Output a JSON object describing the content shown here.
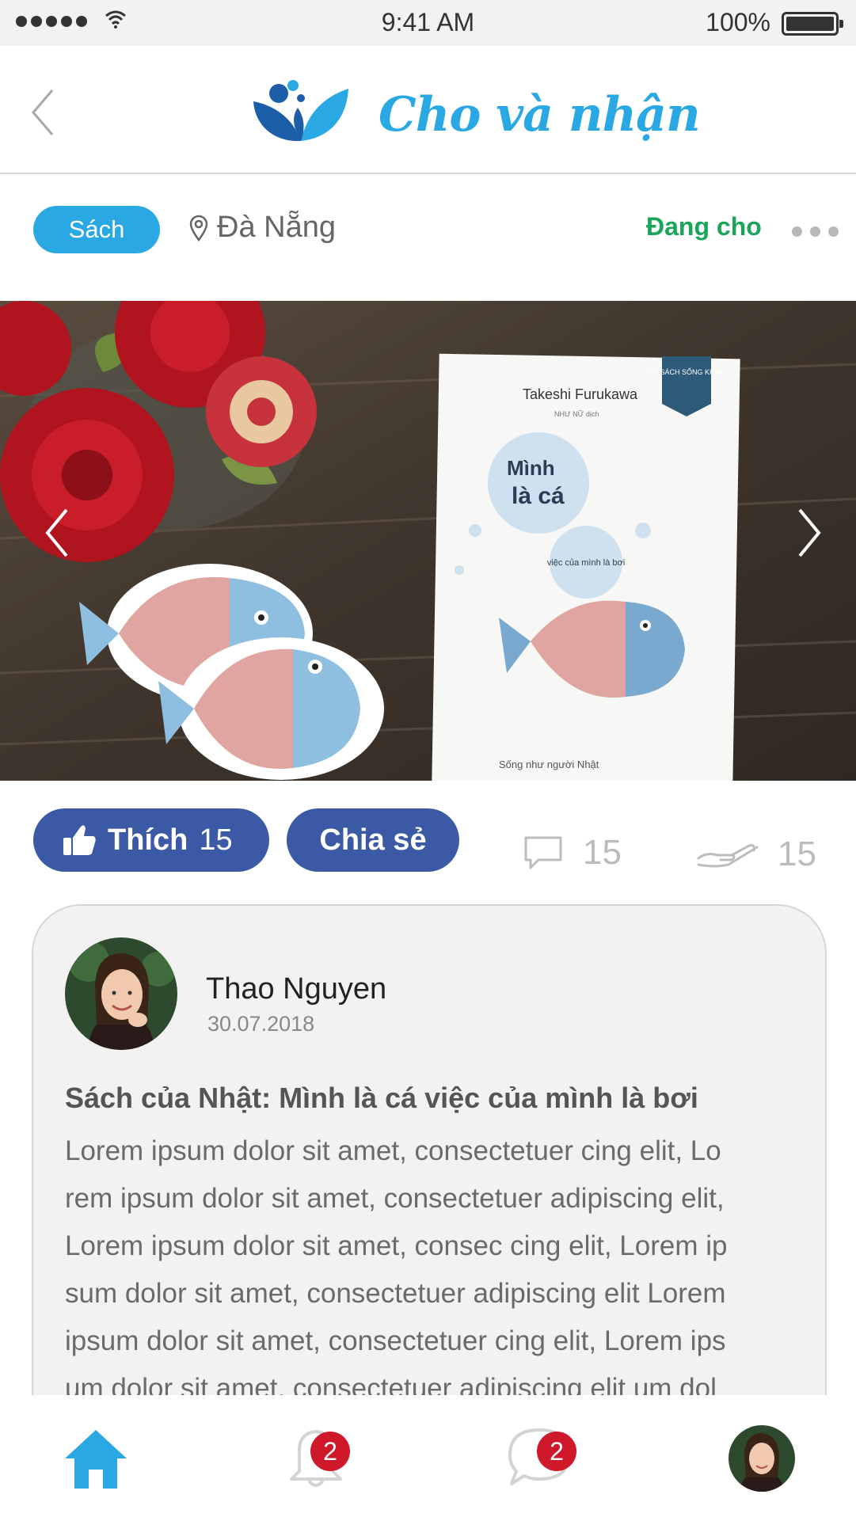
{
  "status_bar": {
    "time": "9:41 AM",
    "battery": "100%"
  },
  "header": {
    "app_title": "Cho và nhận",
    "logo_color": "#2aa8e4"
  },
  "post_meta": {
    "category": "Sách",
    "location": "Đà Nẵng",
    "status": "Đang cho"
  },
  "actions": {
    "like_label": "Thích",
    "like_count": "15",
    "share_label": "Chia sẻ",
    "comment_count": "15",
    "receive_count": "15"
  },
  "post": {
    "author": "Thao Nguyen",
    "date": "30.07.2018",
    "title": "Sách của Nhật: Mình là cá việc của mình là bơi",
    "body_lines": [
      "Lorem ipsum dolor sit amet, consectetuer  cing elit, Lo",
      "rem ipsum dolor sit amet, consectetuer adipiscing elit,",
      "Lorem ipsum dolor sit amet, consec cing elit, Lorem ip",
      "sum dolor sit amet, consectetuer adipiscing elit Lorem",
      "ipsum dolor sit amet, consectetuer cing elit, Lorem ips",
      "um dolor sit amet, consectetuer adipiscing elit um dol"
    ]
  },
  "book_cover": {
    "series": "TỦ SÁCH SỐNG KHÁC",
    "author": "Takeshi Furukawa",
    "translator": "NHƯ NỮ dịch",
    "title_line1": "Mình",
    "title_line2": "là cá",
    "subtitle": "việc của mình là bơi",
    "tagline": "Sống như người Nhật"
  },
  "nav": {
    "bell_badge": "2",
    "chat_badge": "2"
  },
  "colors": {
    "accent": "#2aa8e4",
    "facebook_blue": "#3b59a5",
    "status_green": "#1aa55a",
    "badge_red": "#d0182b"
  },
  "icons": [
    "back-icon",
    "logo-icon",
    "location-pin-icon",
    "more-dots-icon",
    "chevron-left-icon",
    "chevron-right-icon",
    "thumbs-up-icon",
    "comment-icon",
    "receive-hand-icon",
    "home-icon",
    "bell-icon",
    "chat-icon"
  ]
}
